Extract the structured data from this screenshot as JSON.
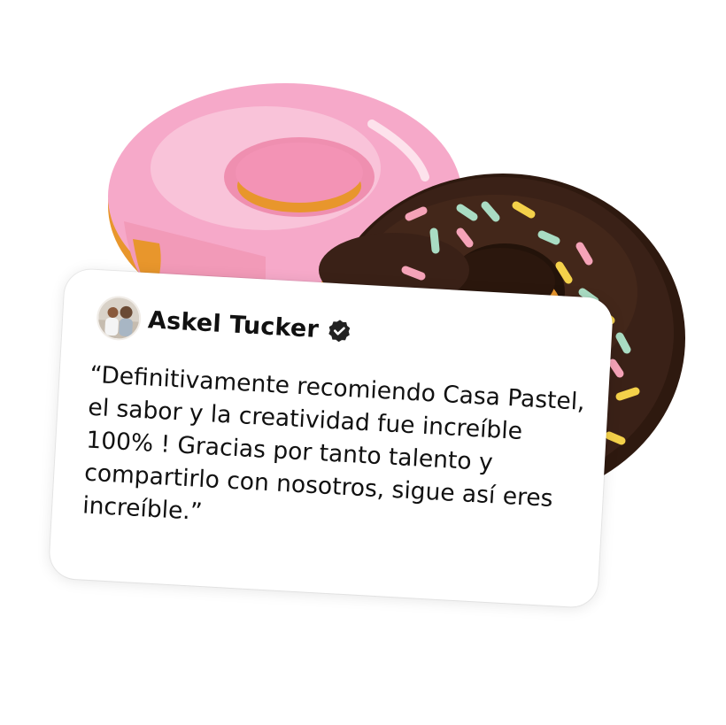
{
  "testimonial": {
    "author": "Askel Tucker",
    "verified": true,
    "badge_icon": "verified-badge-icon",
    "avatar_icon": "couple-photo-avatar",
    "quote": "“Definitivamente recomiendo Casa Pastel, el sabor y la creatividad fue increíble 100% ! Gracias por tanto talento y compartirlo con nosotros, sigue así eres increíble.”"
  },
  "illustration": {
    "items": [
      "pink-glazed-donut",
      "chocolate-sprinkle-donut"
    ],
    "colors": {
      "pink_glaze": "#f6a9c9",
      "pink_highlight": "#fbcfe0",
      "chocolate": "#3a2117",
      "dough": "#e8962c",
      "sprinkles": [
        "#f5a3b8",
        "#a9dcc3",
        "#f4d14a"
      ]
    }
  }
}
